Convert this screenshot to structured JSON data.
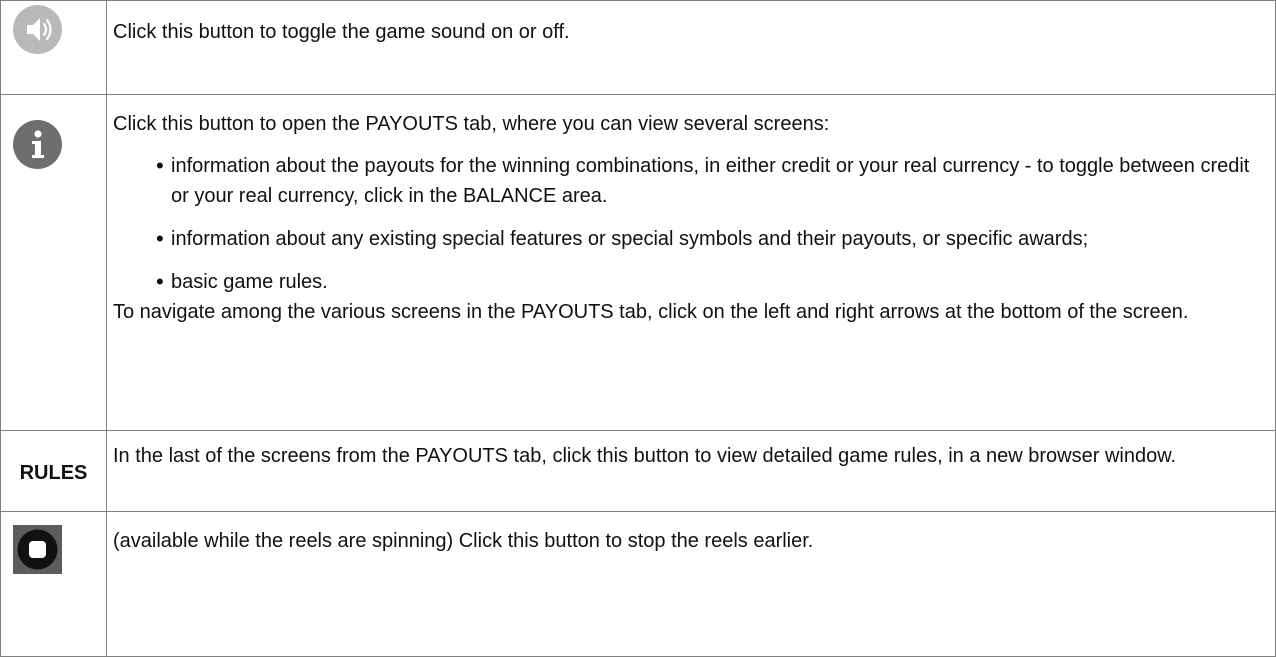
{
  "rows": {
    "sound": {
      "icon": "speaker-icon",
      "text": "Click this button to toggle the game sound on or off."
    },
    "payouts": {
      "icon": "info-icon",
      "intro": "Click this button to open the PAYOUTS tab, where you can view several screens:",
      "bullets": [
        "information about the payouts for the winning combinations, in either credit or your real currency - to toggle between credit or your real currency, click in the BALANCE area.",
        "information about any existing special features or special symbols and their payouts, or specific awards;",
        "basic game rules."
      ],
      "nav": "To navigate among the various screens in the PAYOUTS tab, click on the left and right arrows at the bottom of the screen."
    },
    "rules": {
      "label": "RULES",
      "text": "In the last of the screens from the PAYOUTS tab, click this button to view detailed game rules, in a new browser window."
    },
    "stop": {
      "icon": "stop-icon",
      "text": "(available while the reels are spinning) Click this button to stop the reels earlier."
    }
  },
  "colors": {
    "border": "#7f7f7f",
    "sound_button": "#b9b9b9",
    "info_button": "#6e6e6e",
    "stop_button": "#5c5c5c"
  }
}
